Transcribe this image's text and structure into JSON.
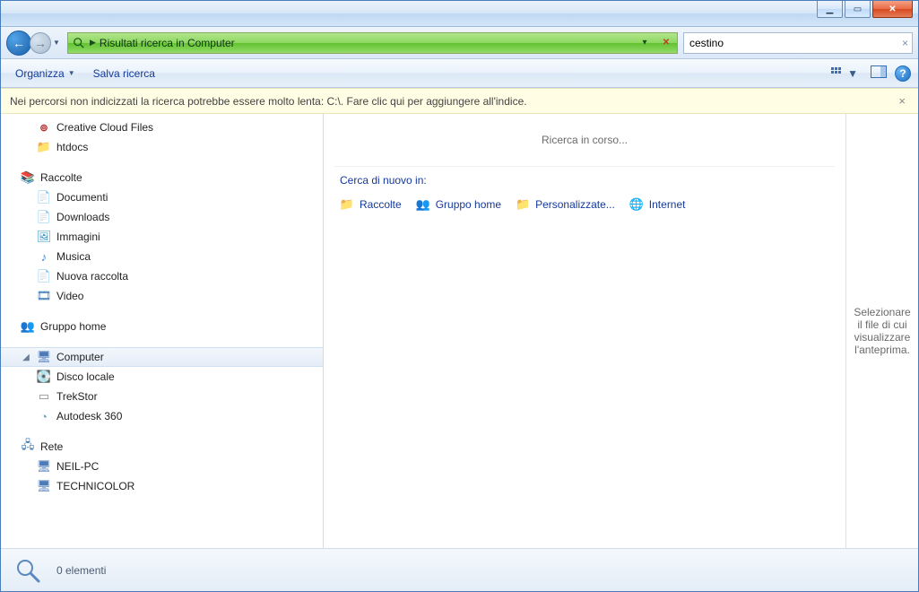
{
  "caption": {
    "min": "—",
    "max": "▢",
    "close": "✕"
  },
  "nav": {
    "address_text": "Risultati ricerca in Computer",
    "search_value": "cestino"
  },
  "cmd": {
    "organize": "Organizza",
    "save_search": "Salva ricerca"
  },
  "infobar": {
    "message": "Nei percorsi non indicizzati la ricerca potrebbe essere molto lenta: C:\\. Fare clic qui per aggiungere all'indice."
  },
  "tree": {
    "favorites_extra": [
      {
        "key": "cc",
        "label": "Creative Cloud Files",
        "icon": "cc"
      },
      {
        "key": "htdocs",
        "label": "htdocs",
        "icon": "folder"
      }
    ],
    "libraries": {
      "label": "Raccolte",
      "items": [
        {
          "key": "docs",
          "label": "Documenti",
          "icon": "doc"
        },
        {
          "key": "downloads",
          "label": "Downloads",
          "icon": "dl"
        },
        {
          "key": "images",
          "label": "Immagini",
          "icon": "img"
        },
        {
          "key": "music",
          "label": "Musica",
          "icon": "music"
        },
        {
          "key": "newlib",
          "label": "Nuova raccolta",
          "icon": "doc"
        },
        {
          "key": "video",
          "label": "Video",
          "icon": "video"
        }
      ]
    },
    "homegroup": {
      "label": "Gruppo home"
    },
    "computer": {
      "label": "Computer",
      "items": [
        {
          "key": "localdisk",
          "label": "Disco locale",
          "icon": "drive"
        },
        {
          "key": "trekstor",
          "label": "TrekStor",
          "icon": "usb"
        },
        {
          "key": "autodesk",
          "label": "Autodesk 360",
          "icon": "autodesk"
        }
      ]
    },
    "network": {
      "label": "Rete",
      "items": [
        {
          "key": "neil",
          "label": "NEIL-PC",
          "icon": "pc"
        },
        {
          "key": "tech",
          "label": "TECHNICOLOR",
          "icon": "pc"
        }
      ]
    }
  },
  "content": {
    "searching": "Ricerca in corso...",
    "again_label": "Cerca di nuovo in:",
    "again_items": [
      {
        "key": "raccolte",
        "label": "Raccolte",
        "icon": "lib"
      },
      {
        "key": "gruppo",
        "label": "Gruppo home",
        "icon": "home"
      },
      {
        "key": "personal",
        "label": "Personalizzate...",
        "icon": "folder"
      },
      {
        "key": "internet",
        "label": "Internet",
        "icon": "internet"
      }
    ]
  },
  "preview": {
    "text": "Selezionare il file di cui visualizzare l'anteprima."
  },
  "status": {
    "text": "0 elementi"
  }
}
